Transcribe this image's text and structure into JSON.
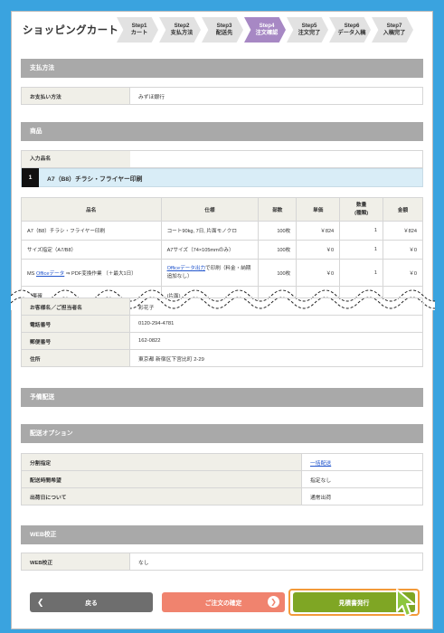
{
  "header": {
    "title": "ショッピングカート",
    "steps": [
      {
        "num": "Step1",
        "label": "カート"
      },
      {
        "num": "Step2",
        "label": "支払方法"
      },
      {
        "num": "Step3",
        "label": "配送先"
      },
      {
        "num": "Step4",
        "label": "注文確認"
      },
      {
        "num": "Step5",
        "label": "注文完了"
      },
      {
        "num": "Step6",
        "label": "データ入稿"
      },
      {
        "num": "Step7",
        "label": "入稿完了"
      }
    ]
  },
  "payment": {
    "heading": "支払方法",
    "label": "お支払い方法",
    "value": "みずほ銀行"
  },
  "product": {
    "heading": "商品",
    "input_name_label": "入力品名",
    "item_no": "1",
    "item_name": "A7（B8）チラシ・フライヤー印刷",
    "columns": [
      "品名",
      "仕様",
      "部数",
      "単価",
      "数量\n(種類)",
      "金額"
    ],
    "rows": [
      {
        "name": "A7（B8）チラシ・フライヤー印刷",
        "spec": "コート90kg, 7日, 片面モノクロ",
        "qty": "100枚",
        "price": "￥824",
        "count": "1",
        "amount": "￥824"
      },
      {
        "name": "サイズ指定（A7/B8）",
        "spec": "A7サイズ（74×105mmのみ）",
        "qty": "100枚",
        "price": "￥0",
        "count": "1",
        "amount": "￥0"
      },
      {
        "name_pre": "MS ",
        "name_link": "Officeデータ",
        "name_post": " ⇒ PDF変換作業 （＋最大1日）",
        "spec_link": "Officeデータ出力",
        "spec_post": "で印刷（料金・納期追加なし）",
        "qty": "100枚",
        "price": "￥0",
        "count": "1",
        "amount": "￥0"
      },
      {
        "name": "表裏確",
        "spec": "(片面)",
        "qty": "100枚",
        "price": "￥0",
        "count": "",
        "amount": ""
      }
    ]
  },
  "contact": {
    "name_label": "お客様名／ご担当者名",
    "name_value": "彩花子",
    "phone_label": "電話番号",
    "phone_value": "0120-294-4781",
    "zip_label": "郵便番号",
    "zip_value": "162-0822",
    "address_label": "住所",
    "address_value": "東京都 新宿区下宮比町 2-29"
  },
  "schedule": {
    "heading": "予備配送"
  },
  "delivery": {
    "heading": "配送オプション",
    "split_label": "分割指定",
    "split_value": "一括配送",
    "time_label": "配送時間希望",
    "time_value": "指定なし",
    "ship_label": "出荷日について",
    "ship_value": "通常出荷"
  },
  "web": {
    "heading": "WEB校正",
    "label": "WEB校正",
    "value": "なし"
  },
  "buttons": {
    "back": "戻る",
    "confirm": "ご注文の確定",
    "issue": "見積書発行"
  },
  "colors": {
    "background": "#3aa3df",
    "active_step": "#a788c4",
    "confirm_button": "#f0836e",
    "issue_button": "#7fa624",
    "highlight_border": "#f39a3a"
  }
}
